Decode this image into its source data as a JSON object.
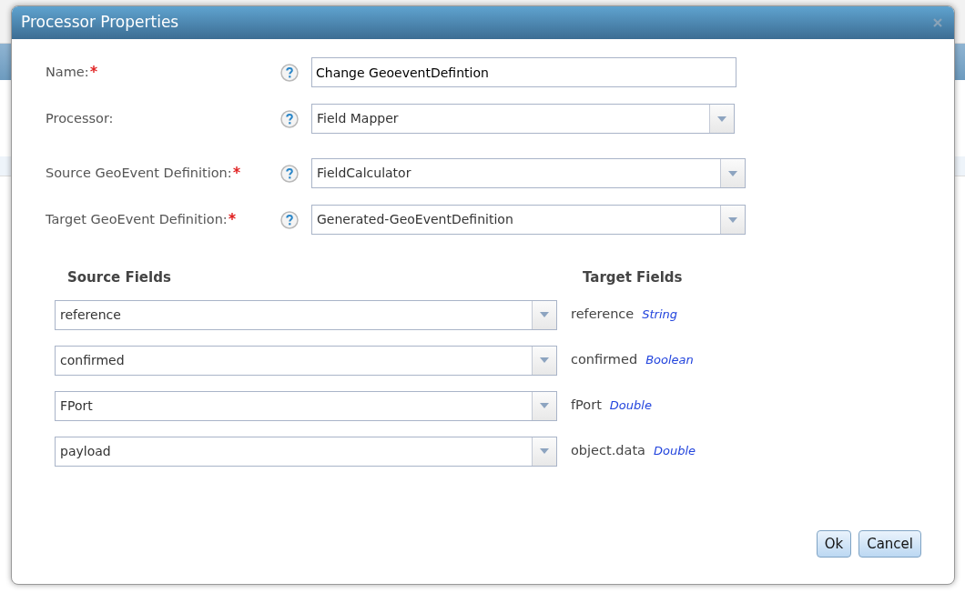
{
  "dialog": {
    "title": "Processor Properties"
  },
  "form": [
    {
      "label": "Name:",
      "required": true,
      "kind": "text",
      "value": "Change GeoeventDefintion"
    },
    {
      "label": "Processor:",
      "required": false,
      "kind": "select",
      "value": "Field Mapper"
    },
    {
      "label": "Source GeoEvent Definition:",
      "required": true,
      "kind": "select",
      "value": "FieldCalculator"
    },
    {
      "label": "Target GeoEvent Definition:",
      "required": true,
      "kind": "select",
      "value": "Generated-GeoEventDefinition"
    }
  ],
  "mapping": {
    "source_heading": "Source Fields",
    "target_heading": "Target Fields",
    "rows": [
      {
        "source": "reference",
        "target": "reference",
        "type": "String"
      },
      {
        "source": "confirmed",
        "target": "confirmed",
        "type": "Boolean"
      },
      {
        "source": "FPort",
        "target": "fPort",
        "type": "Double"
      },
      {
        "source": "payload",
        "target": "object.data",
        "type": "Double"
      }
    ]
  },
  "buttons": [
    "Ok",
    "Cancel"
  ]
}
